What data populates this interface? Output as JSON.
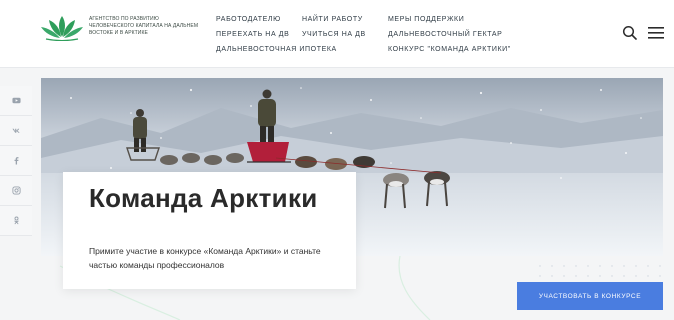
{
  "header": {
    "logo_text": "Агентство по развитию человеческого капитала на Дальнем Востоке и в Арктике",
    "nav": [
      {
        "label": "Работодателю"
      },
      {
        "label": "Найти работу"
      },
      {
        "label": "Меры поддержки"
      },
      {
        "label": "Переехать на ДВ"
      },
      {
        "label": "Учиться на ДВ"
      },
      {
        "label": "Дальневосточный гектар"
      },
      {
        "label": "Дальневосточная ипотека"
      },
      {
        "label": "Конкурс \"Команда Арктики\""
      }
    ],
    "icons": [
      "search-icon",
      "menu-icon"
    ]
  },
  "social": [
    "youtube-icon",
    "vk-icon",
    "facebook-icon",
    "instagram-icon",
    "odnoklassniki-icon"
  ],
  "hero": {
    "title": "Команда Арктики",
    "text": "Примите участие в конкурсе «Команда Арктики» и станьте частью команды профессионалов",
    "cta": "Участвовать в конкурсе"
  },
  "colors": {
    "accent": "#4a7de0",
    "logo_green": "#2f9e5b"
  }
}
